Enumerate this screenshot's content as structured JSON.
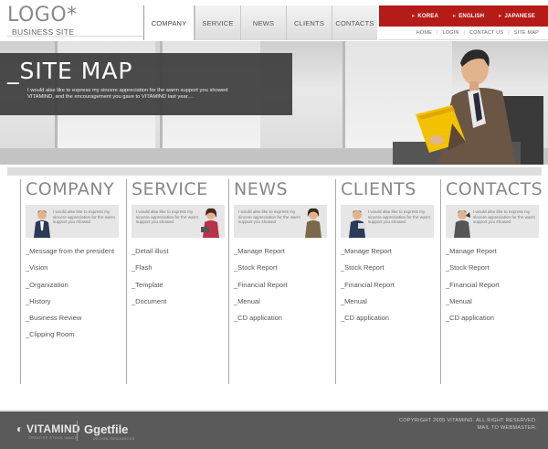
{
  "logo": {
    "main": "LOGO*",
    "sub": "_BUSINESS SITE"
  },
  "nav": [
    "COMPANY",
    "SERVICE",
    "NEWS",
    "CLIENTS",
    "CONTACTS"
  ],
  "languages": [
    "KOREA",
    "ENGLISH",
    "JAPANESE"
  ],
  "utility_links": [
    "HOME",
    "LOGIN",
    "CONTACT US",
    "SITE MAP"
  ],
  "hero": {
    "title": "_SITE MAP",
    "text": "I would alse like to express my sincere appreciation for the warm support you showed VITAMIND, and the encouragement you gave to VITAMIND last year...."
  },
  "banner_text": "I would alse like to express my sincere appreciation for the warm support you showed",
  "columns": [
    {
      "title": "COMPANY",
      "links": [
        "_Message from the president",
        "_Vision",
        "_Organization",
        "_History",
        "_Business Review",
        "_Clipping Room"
      ]
    },
    {
      "title": "SERVICE",
      "links": [
        "_Detail illust",
        "_Flash",
        "_Template",
        "_Document"
      ]
    },
    {
      "title": "NEWS",
      "links": [
        "_Manage Report",
        "_Stock Report",
        "_Financial Report",
        "_Menual",
        "_CD application"
      ]
    },
    {
      "title": "CLIENTS",
      "links": [
        "_Manage Report",
        "_Stock Report",
        "_Financial Report",
        "_Menual",
        "_CD application"
      ]
    },
    {
      "title": "CONTACTS",
      "links": [
        "_Manage Report",
        "_Stock Report",
        "_Financial Report",
        "_Menual",
        "_CD application"
      ]
    }
  ],
  "footer": {
    "brand1": "VITAMIND",
    "brand1_sub": "CREATIVE STOCK IMAGE",
    "brand2": "getfile",
    "brand2_sub": "DESIGN RESOURCES",
    "copyright_line1": "COPYRIGHT 2005 VITAMIND. ALL RIGHT RESERVED.",
    "copyright_line2": "MAIL TO WEBMASTER."
  },
  "colors": {
    "accent": "#b51b17",
    "dark_panel": "#3c3c3c",
    "footer": "#5a5a5a",
    "text": "#555555"
  }
}
